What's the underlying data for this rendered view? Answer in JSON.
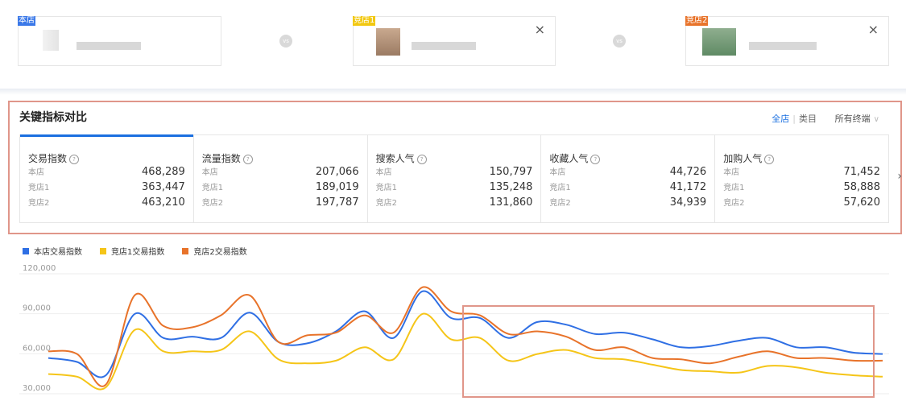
{
  "stores": [
    {
      "tag": "本店",
      "tag_color": "#3a78e8",
      "closable": false
    },
    {
      "tag": "竞店1",
      "tag_color": "#f2c811",
      "closable": true
    },
    {
      "tag": "竞店2",
      "tag_color": "#e8732a",
      "closable": true
    }
  ],
  "vs_label": "vs",
  "close_glyph": "×",
  "panel": {
    "title": "关键指标对比",
    "scope_all": "全店",
    "scope_separator": "|",
    "scope_category": "类目",
    "terminal": "所有终端",
    "terminal_chevron": "∨",
    "help_glyph": "?",
    "next_arrow": "›",
    "row_labels": [
      "本店",
      "竞店1",
      "竞店2"
    ],
    "metrics": [
      {
        "name": "交易指数",
        "values": [
          "468,289",
          "363,447",
          "463,210"
        ],
        "active": true
      },
      {
        "name": "流量指数",
        "values": [
          "207,066",
          "189,019",
          "197,787"
        ],
        "active": false
      },
      {
        "name": "搜索人气",
        "values": [
          "150,797",
          "135,248",
          "131,860"
        ],
        "active": false
      },
      {
        "name": "收藏人气",
        "values": [
          "44,726",
          "41,172",
          "34,939"
        ],
        "active": false
      },
      {
        "name": "加购人气",
        "values": [
          "71,452",
          "58,888",
          "57,620"
        ],
        "active": false
      }
    ]
  },
  "chart_data": {
    "type": "line",
    "y_tick_labels": [
      "120,000",
      "90,000",
      "60,000",
      "30,000"
    ],
    "ylim": [
      30000,
      120000
    ],
    "grid": true,
    "legend_position": "top-left",
    "series": [
      {
        "name": "本店交易指数",
        "color": "#2f6fe4",
        "values": [
          52000,
          49000,
          39000,
          85000,
          67000,
          68000,
          67000,
          86000,
          64000,
          63000,
          72000,
          87000,
          67000,
          102000,
          82000,
          82000,
          67000,
          79000,
          77000,
          70000,
          71000,
          66000,
          60000,
          61000,
          65000,
          67000,
          60000,
          60000,
          56000,
          55000
        ]
      },
      {
        "name": "竞店1交易指数",
        "color": "#f5c518",
        "values": [
          40000,
          38000,
          30000,
          73000,
          57000,
          57000,
          58000,
          72000,
          51000,
          48000,
          50000,
          60000,
          51000,
          85000,
          66000,
          67000,
          50000,
          55000,
          58000,
          52000,
          51000,
          47000,
          43000,
          42000,
          41000,
          46000,
          45000,
          41000,
          39000,
          38000
        ]
      },
      {
        "name": "竞店2交易指数",
        "color": "#e8732a",
        "values": [
          57000,
          55000,
          32000,
          99000,
          76000,
          75000,
          84000,
          99000,
          64000,
          69000,
          71000,
          84000,
          71000,
          105000,
          87000,
          84000,
          70000,
          72000,
          68000,
          58000,
          60000,
          52000,
          51000,
          48000,
          53000,
          57000,
          52000,
          52000,
          50000,
          50000
        ]
      }
    ]
  }
}
